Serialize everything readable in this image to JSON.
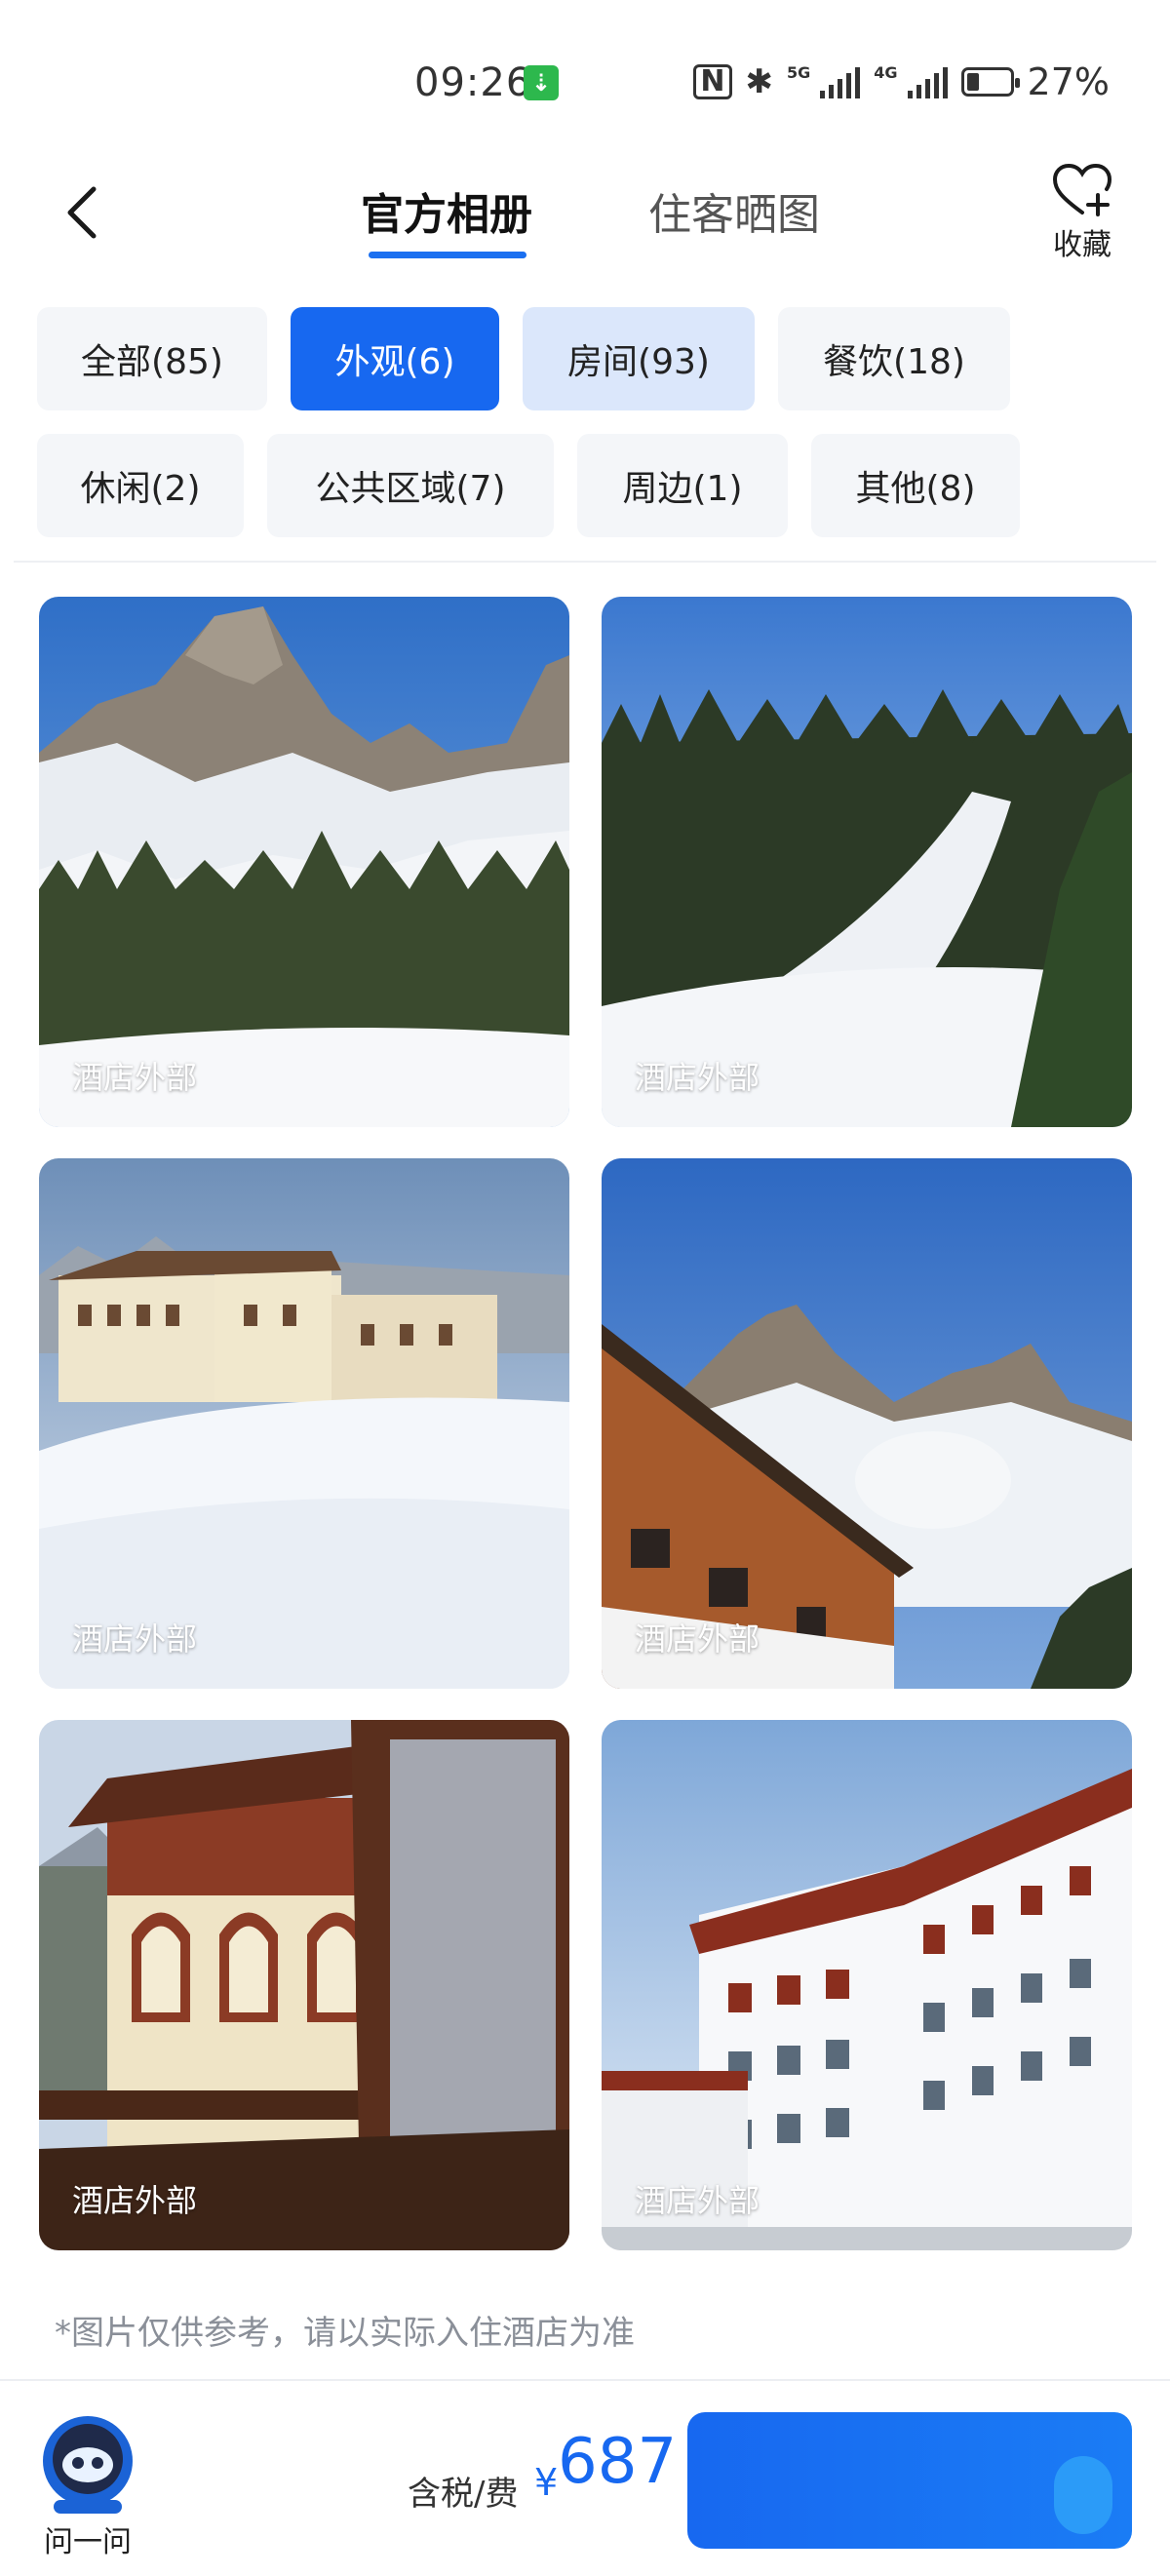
{
  "status_bar": {
    "time": "09:26",
    "charge_badge": "⇣",
    "network": "5G",
    "network2": "4G",
    "battery": "27%"
  },
  "nav": {
    "tabs": [
      {
        "label": "官方相册"
      },
      {
        "label": "住客晒图"
      }
    ],
    "favorite_label": "收藏"
  },
  "filters": [
    {
      "label": "全部(85)"
    },
    {
      "label": "外观(6)"
    },
    {
      "label": "房间(93)"
    },
    {
      "label": "餐饮(18)"
    },
    {
      "label": "休闲(2)"
    },
    {
      "label": "公共区域(7)"
    },
    {
      "label": "周边(1)"
    },
    {
      "label": "其他(8)"
    }
  ],
  "photos": [
    {
      "caption": "酒店外部"
    },
    {
      "caption": "酒店外部"
    },
    {
      "caption": "酒店外部"
    },
    {
      "caption": "酒店外部"
    },
    {
      "caption": "酒店外部"
    },
    {
      "caption": "酒店外部"
    }
  ],
  "disclaimer": "*图片仅供参考，请以实际入住酒店为准",
  "bottom_bar": {
    "ask_label": "问一问",
    "price_label": "含税/费",
    "currency": "¥",
    "price": "687"
  },
  "colors": {
    "accent": "#1768f0",
    "chip_bg": "#f4f6f9",
    "chip_light": "#dbe7fb"
  }
}
